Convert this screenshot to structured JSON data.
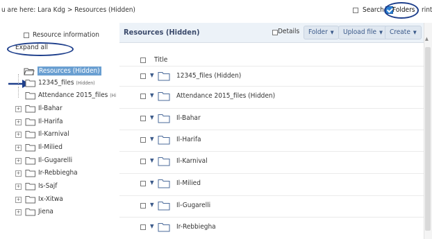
{
  "topbar": {
    "breadcrumb": "u are here: Lara Kdg > Resources (Hidden)",
    "search_label": "Search",
    "folders_label": "Folders",
    "print_label": "rint"
  },
  "left_panel": {
    "resource_info_label": "Resource information",
    "expand_all_label": "Expand all",
    "root_label": "Resources (Hidden)",
    "items": [
      {
        "label": "12345_files",
        "hidden_tag": "(Hidden)",
        "expander": false
      },
      {
        "label": "Attendance 2015_files",
        "hidden_tag": "(Hi",
        "expander": false
      },
      {
        "label": "Il-Bahar",
        "hidden_tag": "",
        "expander": true
      },
      {
        "label": "Il-Harifa",
        "hidden_tag": "",
        "expander": true
      },
      {
        "label": "Il-Karnival",
        "hidden_tag": "",
        "expander": true
      },
      {
        "label": "Il-Milied",
        "hidden_tag": "",
        "expander": true
      },
      {
        "label": "Il-Gugarelli",
        "hidden_tag": "",
        "expander": true
      },
      {
        "label": "Ir-Rebbiegha",
        "hidden_tag": "",
        "expander": true
      },
      {
        "label": "Is-Sajf",
        "hidden_tag": "",
        "expander": true
      },
      {
        "label": "Ix-Xitwa",
        "hidden_tag": "",
        "expander": true
      },
      {
        "label": "Jiena",
        "hidden_tag": "",
        "expander": true
      }
    ]
  },
  "main": {
    "header_title": "Resources (Hidden)",
    "details_label": "Details",
    "folder_button": "Folder",
    "upload_button": "Upload file",
    "create_button": "Create",
    "title_column": "Title",
    "rows": [
      {
        "label": "12345_files (Hidden)"
      },
      {
        "label": "Attendance 2015_files (Hidden)"
      },
      {
        "label": "Il-Bahar"
      },
      {
        "label": "Il-Harifa"
      },
      {
        "label": "Il-Karnival"
      },
      {
        "label": "Il-Milied"
      },
      {
        "label": "Il-Gugarelli"
      },
      {
        "label": "Ir-Rebbiegha"
      }
    ]
  },
  "icons": {
    "folder": "folder-icon",
    "open_folder": "folder-open-icon",
    "arrow": "arrow-right-icon",
    "caret": "caret-down-icon",
    "expander": "plus-expander-icon"
  },
  "colors": {
    "accent": "#2a7fd4",
    "annotation": "#1e3f8c",
    "header_bg": "#ecf2f8",
    "selected_bg": "#6a9fd1"
  }
}
